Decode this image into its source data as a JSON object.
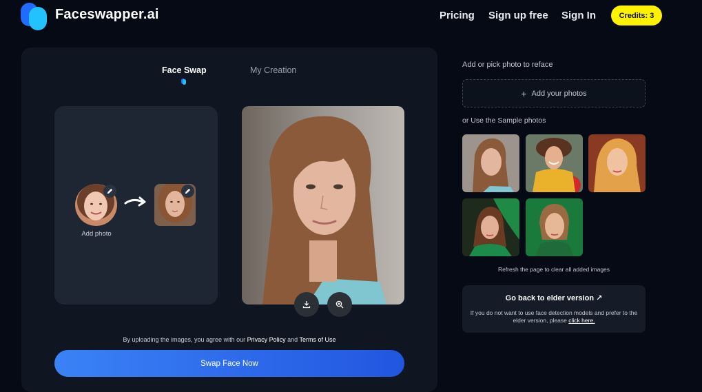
{
  "header": {
    "brand": "Faceswapper.ai",
    "nav": [
      "Pricing",
      "Sign up free",
      "Sign In"
    ],
    "credits": "Credits: 3"
  },
  "tabs": [
    {
      "label": "Face Swap",
      "active": true
    },
    {
      "label": "My Creation",
      "active": false
    }
  ],
  "editor": {
    "add_photo_label": "Add photo",
    "agree_prefix": "By uploading the images, you agree with our",
    "privacy_label": "Privacy Policy",
    "and_label": "and",
    "terms_label": "Terms of Use",
    "swap_button": "Swap Face Now",
    "icons": [
      "pencil-icon",
      "arrow-icon",
      "download-icon",
      "zoom-in-icon"
    ]
  },
  "sidebar": {
    "add_title": "Add or pick photo to reface",
    "add_button": "Add your photos",
    "sample_title": "or Use the Sample photos",
    "refresh_note": "Refresh the page to clear all added images",
    "elder_title": "Go back to elder version ↗",
    "elder_text": "If you do not want to use face detection models and prefer to the elder version, please",
    "elder_link": "click here."
  },
  "colors": {
    "background": "#050a14",
    "panel": "#0f1622",
    "accent_blue": "#3b82f6",
    "credits_yellow": "#fff200"
  }
}
